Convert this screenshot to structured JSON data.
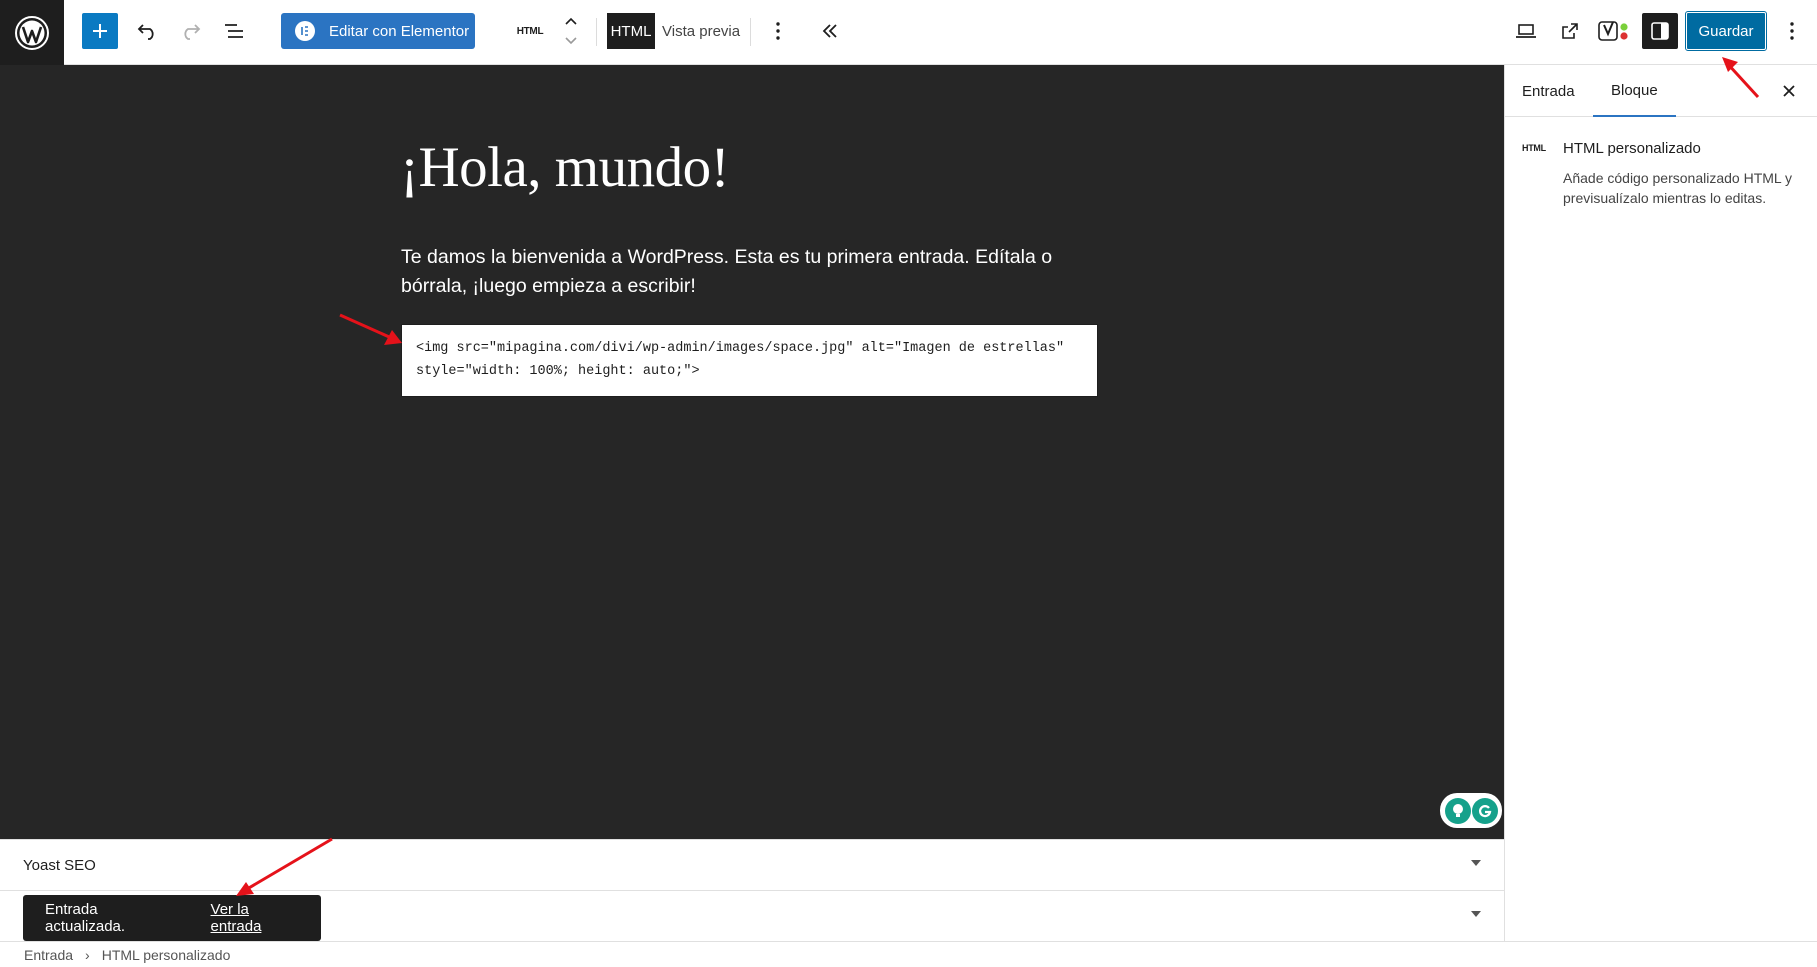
{
  "toolbar": {
    "elementor_label": "Editar con Elementor",
    "block_type": "HTML",
    "html_tab": "HTML",
    "preview_tab": "Vista previa",
    "save_label": "Guardar"
  },
  "canvas": {
    "title": "¡Hola, mundo!",
    "paragraph": "Te damos la bienvenida a WordPress. Esta es tu primera entrada. Edítala o bórrala, ¡luego empieza a escribir!",
    "html_code": "<img src=\"mipagina.com/divi/wp-admin/images/space.jpg\" alt=\"Imagen de estrellas\"\nstyle=\"width: 100%; height: auto;\">"
  },
  "metaboxes": {
    "yoast_title": "Yoast SEO"
  },
  "snackbar": {
    "message": "Entrada actualizada.",
    "link": "Ver la entrada"
  },
  "breadcrumb": {
    "root": "Entrada",
    "separator": "›",
    "current": "HTML personalizado"
  },
  "sidebar": {
    "tabs": [
      {
        "label": "Entrada",
        "active": false
      },
      {
        "label": "Bloque",
        "active": true
      }
    ],
    "block_icon": "HTML",
    "block_title": "HTML personalizado",
    "block_description": "Añade código personalizado HTML y previsualízalo mientras lo editas."
  },
  "icons": {
    "logo": "wordpress-logo-icon",
    "add": "plus-icon",
    "undo": "undo-icon",
    "redo": "redo-icon",
    "list_view": "list-view-icon",
    "move": "chevron-up-down-icon",
    "more": "vertical-ellipsis-icon",
    "collapse": "double-chevron-left-icon",
    "view": "laptop-icon",
    "external": "external-link-icon",
    "yoast": "yoast-icon",
    "settings": "sidebar-panel-icon",
    "close": "close-icon",
    "grammarly": "grammarly-icon"
  },
  "colors": {
    "accent": "#2b74c2",
    "primary_button": "#006ba1",
    "canvas_bg": "#262626",
    "annotation": "#e5121a"
  }
}
